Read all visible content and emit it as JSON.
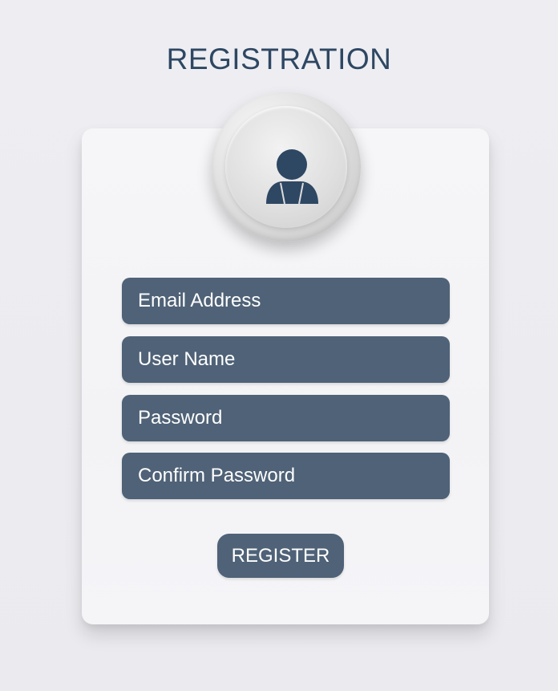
{
  "header": {
    "title": "REGISTRATION"
  },
  "avatar": {
    "icon": "user-icon",
    "icon_color": "#2e4763"
  },
  "form": {
    "email": {
      "placeholder": "Email Address",
      "value": ""
    },
    "username": {
      "placeholder": "User Name",
      "value": ""
    },
    "password": {
      "placeholder": "Password",
      "value": ""
    },
    "confirm_password": {
      "placeholder": "Confirm Password",
      "value": ""
    },
    "submit_label": "REGISTER"
  },
  "colors": {
    "title": "#2e4763",
    "field_background": "#4f6277",
    "field_text": "#ffffff",
    "card_background": "#f5f5f7",
    "page_background": "#ececf0"
  }
}
